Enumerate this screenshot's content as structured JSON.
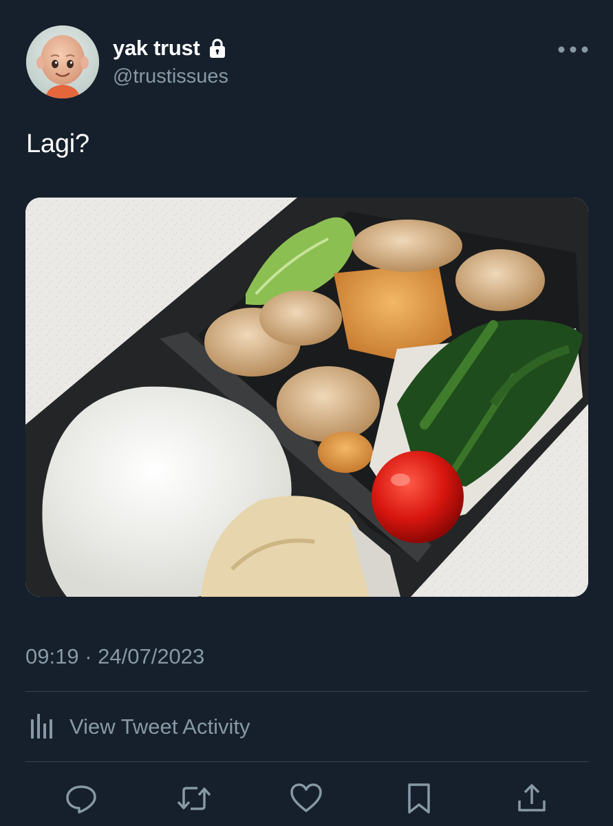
{
  "tweet": {
    "author": {
      "display_name": "yak trust",
      "handle": "@trustissues",
      "protected_icon": "lock-icon",
      "avatar_icon": "avatar"
    },
    "text": "Lagi?",
    "timestamp": "09:19 · 24/07/2023",
    "activity_label": "View Tweet Activity"
  },
  "actions": [
    {
      "name": "reply",
      "icon": "reply-icon"
    },
    {
      "name": "retweet",
      "icon": "retweet-icon"
    },
    {
      "name": "like",
      "icon": "heart-icon"
    },
    {
      "name": "bookmark",
      "icon": "bookmark-icon"
    },
    {
      "name": "share",
      "icon": "share-icon"
    }
  ],
  "colors": {
    "background": "#16202c",
    "primary_text": "#ffffff",
    "secondary_text": "#8899a6",
    "divider": "#38444d"
  }
}
